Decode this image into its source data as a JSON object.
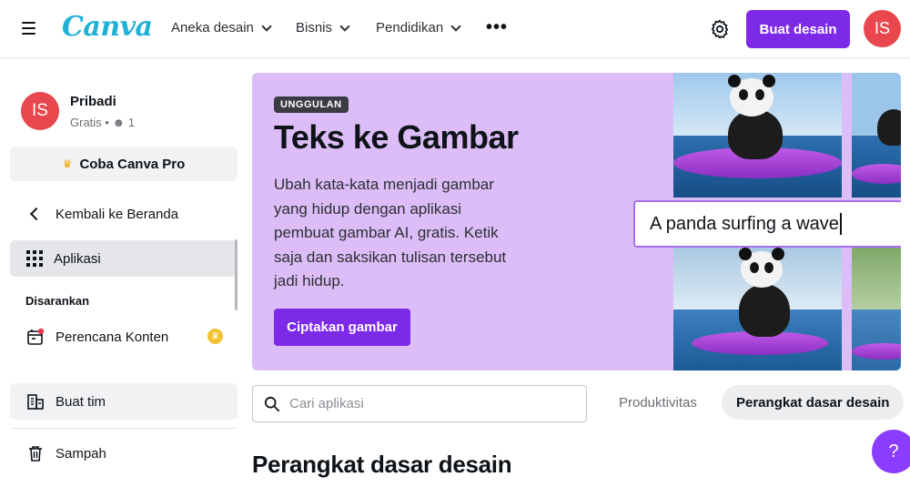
{
  "header": {
    "logo": "Canva",
    "nav": [
      "Aneka desain",
      "Bisnis",
      "Pendidikan"
    ],
    "more": "•••",
    "create_label": "Buat desain",
    "avatar_initials": "IS"
  },
  "sidebar": {
    "profile": {
      "initials": "IS",
      "name": "Pribadi",
      "plan": "Gratis",
      "members": "1"
    },
    "pro_label": "Coba Canva Pro",
    "back_label": "Kembali ke Beranda",
    "apps_label": "Aplikasi",
    "suggested_heading": "Disarankan",
    "content_planner_label": "Perencana Konten",
    "team_label": "Buat tim",
    "trash_label": "Sampah"
  },
  "banner": {
    "badge": "UNGGULAN",
    "title": "Teks ke Gambar",
    "description": "Ubah kata-kata menjadi gambar yang hidup dengan aplikasi pembuat gambar AI, gratis. Ketik saja dan saksikan tulisan tersebut jadi hidup.",
    "cta": "Ciptakan gambar",
    "prompt": "A panda surfing a wave"
  },
  "search": {
    "placeholder": "Cari aplikasi",
    "value": ""
  },
  "filters": [
    "Produktivitas",
    "Perangkat dasar desain"
  ],
  "section_heading": "Perangkat dasar desain",
  "help_label": "?",
  "colors": {
    "accent": "#7d2ae8",
    "banner_bg": "#dcbdf7",
    "avatar": "#e8484d",
    "logo": "#20b1d6"
  }
}
